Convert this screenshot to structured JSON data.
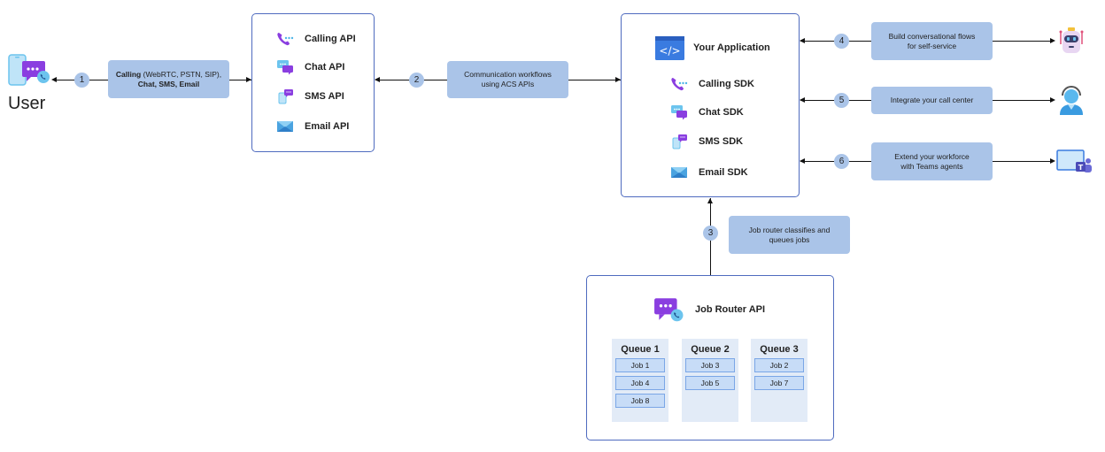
{
  "user": {
    "label": "User",
    "icon": "user-chat-phone-icon"
  },
  "steps": [
    {
      "number": "1",
      "label_bold": "Calling",
      "label_rest": " (WebRTC, PSTN, SIP),",
      "label_line2": "Chat, SMS, Email"
    },
    {
      "number": "2",
      "label": "Communication workflows using ACS APIs"
    },
    {
      "number": "3",
      "label": "Job router classifies and queues jobs"
    },
    {
      "number": "4",
      "label": "Build conversational flows for self-service",
      "target_icon": "bot-icon"
    },
    {
      "number": "5",
      "label": "Integrate your call center",
      "target_icon": "agent-icon"
    },
    {
      "number": "6",
      "label": "Extend your workforce with Teams agents",
      "target_icon": "teams-icon"
    }
  ],
  "api_box": {
    "items": [
      {
        "label": "Calling API",
        "icon": "calling-icon"
      },
      {
        "label": "Chat API",
        "icon": "chat-icon"
      },
      {
        "label": "SMS API",
        "icon": "sms-icon"
      },
      {
        "label": "Email API",
        "icon": "email-icon"
      }
    ]
  },
  "app_box": {
    "title": "Your Application",
    "title_icon": "code-window-icon",
    "items": [
      {
        "label": "Calling SDK",
        "icon": "calling-icon"
      },
      {
        "label": "Chat SDK",
        "icon": "chat-icon"
      },
      {
        "label": "SMS SDK",
        "icon": "sms-icon"
      },
      {
        "label": "Email SDK",
        "icon": "email-icon"
      }
    ]
  },
  "job_router": {
    "title": "Job Router API",
    "icon": "chat-phone-icon",
    "queues": [
      {
        "name": "Queue 1",
        "jobs": [
          "Job 1",
          "Job 4",
          "Job 8"
        ]
      },
      {
        "name": "Queue 2",
        "jobs": [
          "Job 3",
          "Job 5"
        ]
      },
      {
        "name": "Queue 3",
        "jobs": [
          "Job 2",
          "Job 7"
        ]
      }
    ]
  },
  "colors": {
    "box_border": "#4f6bbf",
    "label_fill": "#aac4e8",
    "queue_fill": "#e2ebf7",
    "job_fill": "#c7dcf7",
    "job_border": "#7aa6e6"
  }
}
